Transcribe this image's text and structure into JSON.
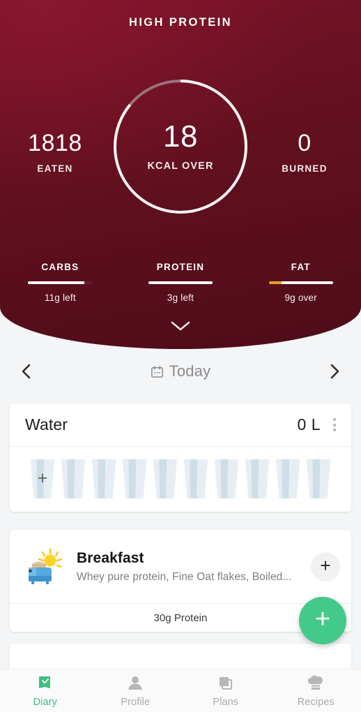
{
  "header": {
    "title": "HIGH PROTEIN",
    "ring": {
      "value": "18",
      "label": "KCAL OVER",
      "progress_percent": 86
    },
    "stats": [
      {
        "name": "eaten",
        "value": "1818",
        "label": "EATEN"
      },
      {
        "name": "burned",
        "value": "0",
        "label": "BURNED"
      }
    ],
    "macros": [
      {
        "name": "CARBS",
        "sub": "11g left",
        "fill_percent": 88,
        "fill_color": "#ffffff",
        "track_color": "#5d2230",
        "lead_color": null
      },
      {
        "name": "PROTEIN",
        "sub": "3g left",
        "fill_percent": 100,
        "fill_color": "#ffffff",
        "track_color": "#5d2230",
        "lead_color": null
      },
      {
        "name": "FAT",
        "sub": "9g over",
        "fill_percent": 100,
        "fill_color": "#ffffff",
        "track_color": "#5d2230",
        "lead_color": "#e8a020"
      }
    ],
    "expand_icon": "chevron-down-icon",
    "bg_top_color": "#791328",
    "bg_bottom_color": "#4e0c19"
  },
  "date_nav": {
    "prev_icon": "chevron-left-icon",
    "next_icon": "chevron-right-icon",
    "calendar_icon": "calendar-icon",
    "label": "Today"
  },
  "water": {
    "title": "Water",
    "amount": "0 L",
    "menu_icon": "kebab-menu-icon",
    "add_icon": "plus-icon",
    "glass_count": 10,
    "glasses_filled": 0
  },
  "meal": {
    "icon": "toaster-sunrise-icon",
    "title": "Breakfast",
    "items_summary": "Whey pure protein, Fine Oat flakes, Boiled...",
    "add_icon": "plus-icon",
    "footer": "30g Protein"
  },
  "fab": {
    "icon": "plus-icon",
    "color": "#43c98a"
  },
  "bottom_nav": {
    "items": [
      {
        "label": "Diary",
        "icon": "diary-book-icon",
        "active": true
      },
      {
        "label": "Profile",
        "icon": "person-icon",
        "active": false
      },
      {
        "label": "Plans",
        "icon": "stacked-cards-icon",
        "active": false
      },
      {
        "label": "Recipes",
        "icon": "chef-hat-icon",
        "active": false
      }
    ],
    "active_color": "#3fbf7f",
    "inactive_color": "#a9aaac"
  }
}
